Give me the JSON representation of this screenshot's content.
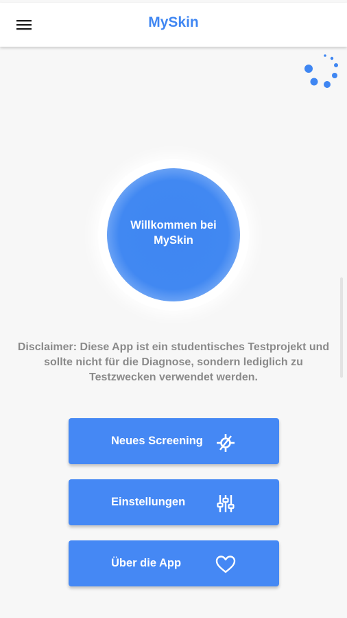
{
  "appbar": {
    "title": "MySkin",
    "menu_icon": "hamburger-menu-icon"
  },
  "status": {
    "loading_icon": "loading-spinner-icon"
  },
  "welcome": {
    "text": "Willkommen bei MySkin"
  },
  "disclaimer": {
    "text": "Disclaimer: Diese App ist ein studentisches Testprojekt und sollte nicht für die Diagnose, sondern lediglich zu Testzwecken verwendet werden."
  },
  "actions": [
    {
      "label": "Neues Screening",
      "icon": "screening-target-icon"
    },
    {
      "label": "Einstellungen",
      "icon": "sliders-icon"
    },
    {
      "label": "Über die App",
      "icon": "heart-outline-icon"
    }
  ],
  "colors": {
    "accent": "#3f86f2",
    "button": "#4588f4",
    "background": "#f7f7f7",
    "text_muted": "#8a8a8a"
  }
}
